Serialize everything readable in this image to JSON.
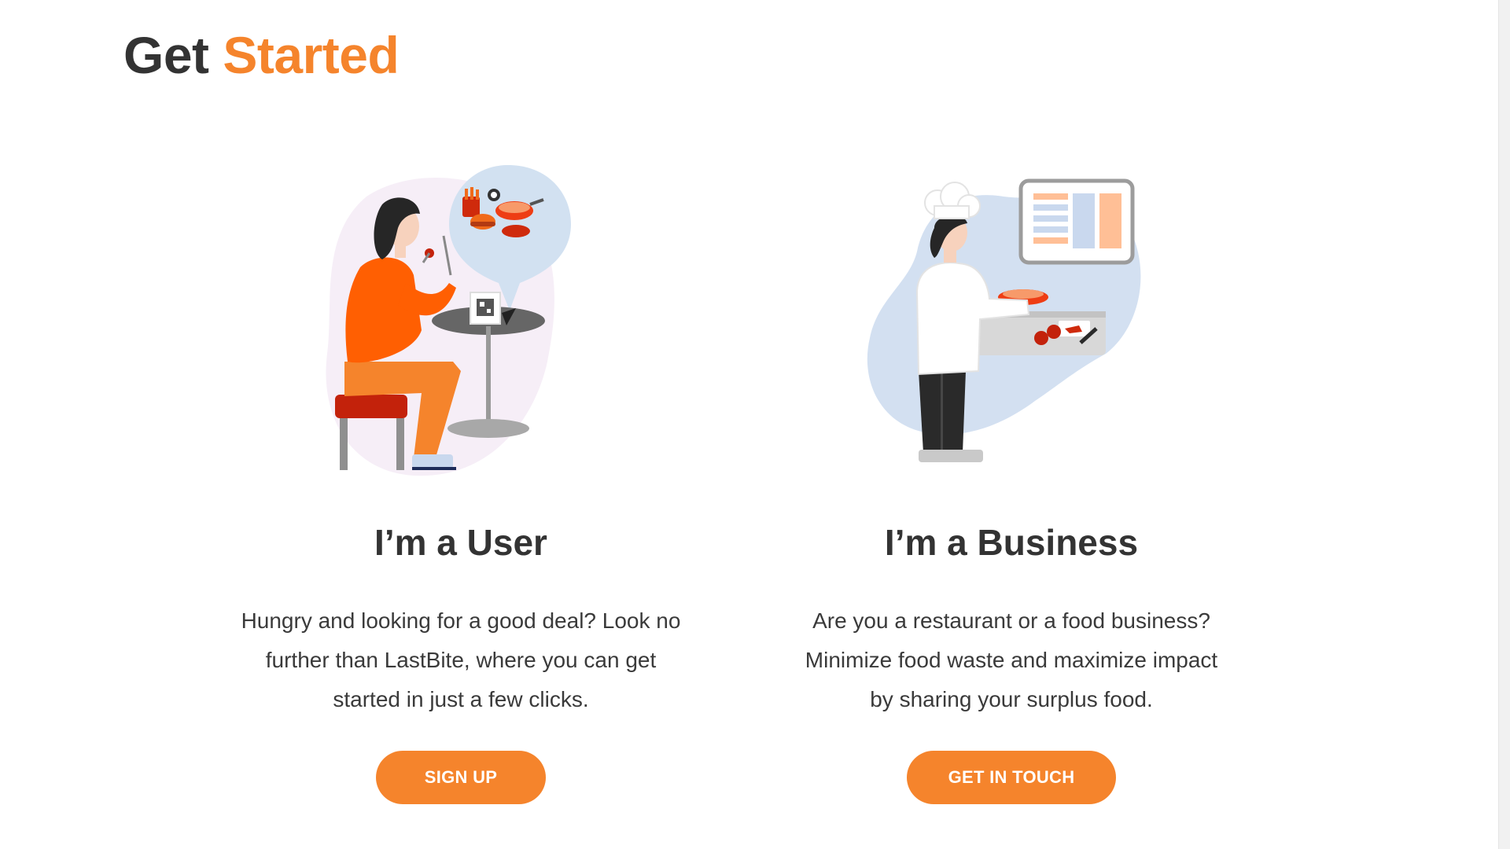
{
  "header": {
    "title_part1": "Get",
    "title_part2": "Started"
  },
  "colors": {
    "accent": "#f5842c",
    "text": "#333333"
  },
  "cards": [
    {
      "title": "I’m a User",
      "description": "Hungry and looking for a good deal? Look no further than LastBite, where you can get started in just a few clicks.",
      "button_label": "SIGN UP",
      "illustration": "woman-dining-icon"
    },
    {
      "title": "I’m a Business",
      "description": "Are you a restaurant or a food business? Minimize food waste and maximize impact by sharing your surplus food.",
      "button_label": "GET IN TOUCH",
      "illustration": "chef-cooking-icon"
    }
  ]
}
